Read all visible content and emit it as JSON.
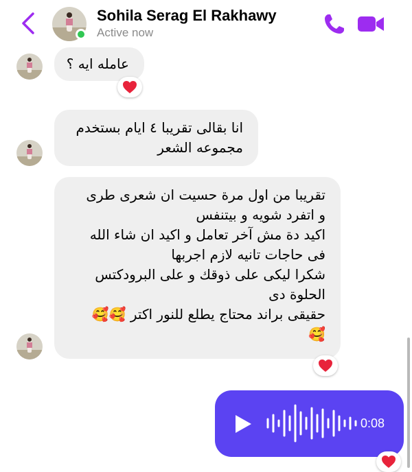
{
  "header": {
    "contact_name": "Sohila Serag El Rakhawy",
    "status": "Active now",
    "icons": [
      "chevron-left-icon",
      "phone-icon",
      "video-camera-icon"
    ],
    "accent_color": "#9d2cf0"
  },
  "messages": [
    {
      "sender": "contact",
      "lines": [
        "عامله ايه ؟"
      ],
      "reaction": "❤️"
    },
    {
      "sender": "contact",
      "lines": [
        "انا بقالى تقريبا ٤ ايام بستخدم",
        "مجموعه الشعر"
      ]
    },
    {
      "sender": "contact",
      "lines": [
        "تقريبا من اول مرة حسيت ان شعرى طرى",
        "و اتفرد شويه و بيتنفس",
        "اكيد دة مش آخر تعامل و اكيد ان شاء الله",
        "فى حاجات تانيه لازم اجربها",
        "شكرا ليكى على ذوقك و على البرودكتس",
        "الحلوة دى",
        "حقيقى براند محتاج يطلع للنور اكتر 🥰🥰",
        "🥰"
      ],
      "reaction": "❤️"
    },
    {
      "sender": "me",
      "type": "voice",
      "duration": "0:08",
      "reaction": "❤️",
      "bubble_color": "#5b43f2"
    }
  ]
}
